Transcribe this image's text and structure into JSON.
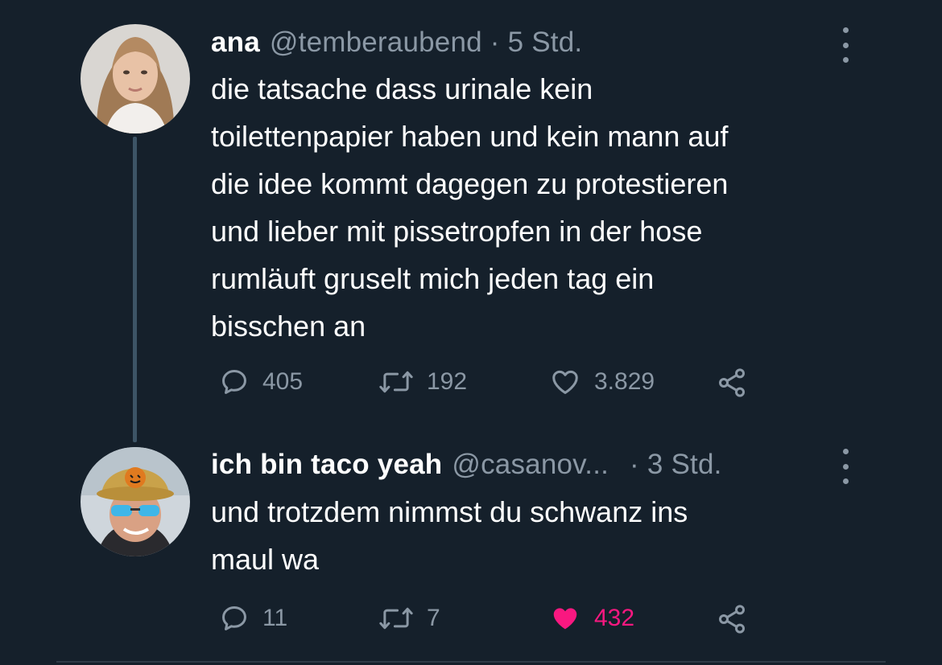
{
  "tweets": [
    {
      "display_name": "ana",
      "handle": "@temberaubend",
      "separator": "·",
      "time": "5 Std.",
      "text": "die tatsache dass urinale kein\ntoilettenpapier haben und kein mann auf\ndie idee kommt dagegen zu protestieren\nund lieber mit pissetropfen in der hose\nrumläuft gruselt mich jeden tag ein\nbisschen an",
      "replies": "405",
      "retweets": "192",
      "likes": "3.829",
      "liked": false
    },
    {
      "display_name": "ich bin taco yeah",
      "handle": "@casanov...",
      "separator": "·",
      "time": "3 Std.",
      "text": "und trotzdem nimmst du schwanz ins\nmaul wa",
      "replies": "11",
      "retweets": "7",
      "likes": "432",
      "liked": true
    }
  ],
  "icons": {
    "reply": "reply-icon",
    "retweet": "retweet-icon",
    "like": "heart-icon",
    "share": "share-icon",
    "more": "more-options-icon"
  },
  "colors": {
    "background": "#15202b",
    "secondary_text": "#8b98a5",
    "like_active": "#f91880",
    "thread_line": "#3d5466"
  }
}
